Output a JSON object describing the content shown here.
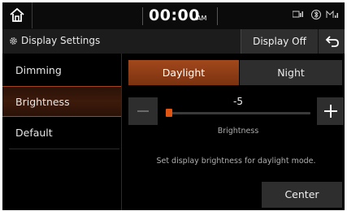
{
  "status_bar": {
    "time": "00:00",
    "ampm": "AM",
    "icons": [
      "media-icon",
      "bluetooth-icon",
      "signal-icon"
    ]
  },
  "header": {
    "title": "Display Settings",
    "display_off_label": "Display Off"
  },
  "sidebar": {
    "items": [
      {
        "label": "Dimming",
        "active": false
      },
      {
        "label": "Brightness",
        "active": true
      },
      {
        "label": "Default",
        "active": false
      }
    ]
  },
  "tabs": [
    {
      "label": "Daylight",
      "active": true
    },
    {
      "label": "Night",
      "active": false
    }
  ],
  "brightness": {
    "value": "-5",
    "label": "Brightness",
    "level_fraction": 0.0
  },
  "hint": "Set display brightness for daylight mode.",
  "center_label": "Center",
  "colors": {
    "accent": "#a2481c",
    "thumb": "#e05512",
    "background": "#000000",
    "button": "#2e2e2e"
  }
}
